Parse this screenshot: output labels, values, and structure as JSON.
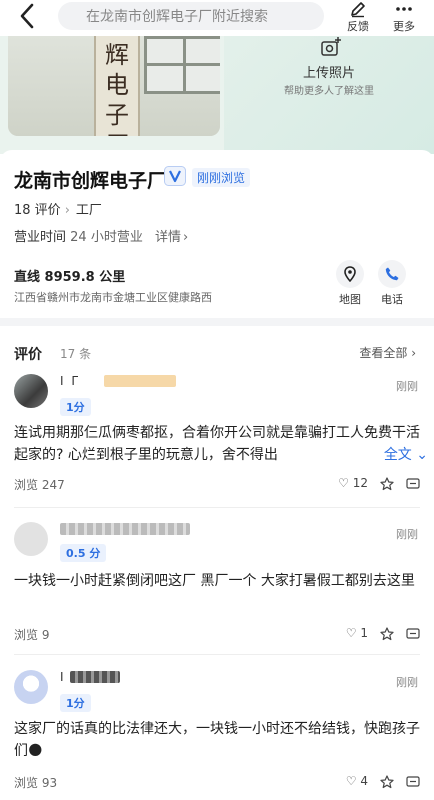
{
  "topbar": {
    "search_placeholder": "在龙南市创辉电子厂附近搜索",
    "feedback_label": "反馈",
    "more_label": "更多"
  },
  "hero": {
    "sign_text": "辉电子厂",
    "upload_label": "上传照片",
    "upload_sub": "帮助更多人了解这里"
  },
  "place": {
    "name": "龙南市创辉电子厂",
    "verified_label": "刚刚浏览",
    "review_count": "18 评价",
    "category": "工厂",
    "hours_label": "营业时间",
    "hours_value": "24 小时营业",
    "details_link": "详情",
    "distance": "直线 8959.8 公里",
    "address": "江西省赣州市龙南市金塘工业区健康路西",
    "map_label": "地图",
    "phone_label": "电话"
  },
  "reviews": {
    "title": "评价",
    "count": "17 条",
    "view_all": "查看全部",
    "expand_label": "全文",
    "items": [
      {
        "user": "I Г",
        "score": "1分",
        "time": "刚刚",
        "text": "连试用期那仨瓜俩枣都抠，合着你开公司就是靠骗打工人免费干活起家的? 心烂到根子里的玩意儿，舍不得出",
        "views": "浏览 247",
        "likes": "12"
      },
      {
        "user": "",
        "score": "0.5 分",
        "time": "刚刚",
        "text": "一块钱一小时赶紧倒闭吧这厂 黑厂一个 大家打暑假工都别去这里",
        "views": "浏览 9",
        "likes": "1"
      },
      {
        "user": "I",
        "score": "1分",
        "time": "刚刚",
        "text": "这家厂的话真的比法律还大，一块钱一小时还不给结钱，快跑孩子们🌑",
        "views": "浏览 93",
        "likes": "4"
      }
    ]
  },
  "colors": {
    "accent": "#2d6fe0",
    "hero_bg": "#eaf3ee",
    "divider": "#f3f4f6"
  }
}
